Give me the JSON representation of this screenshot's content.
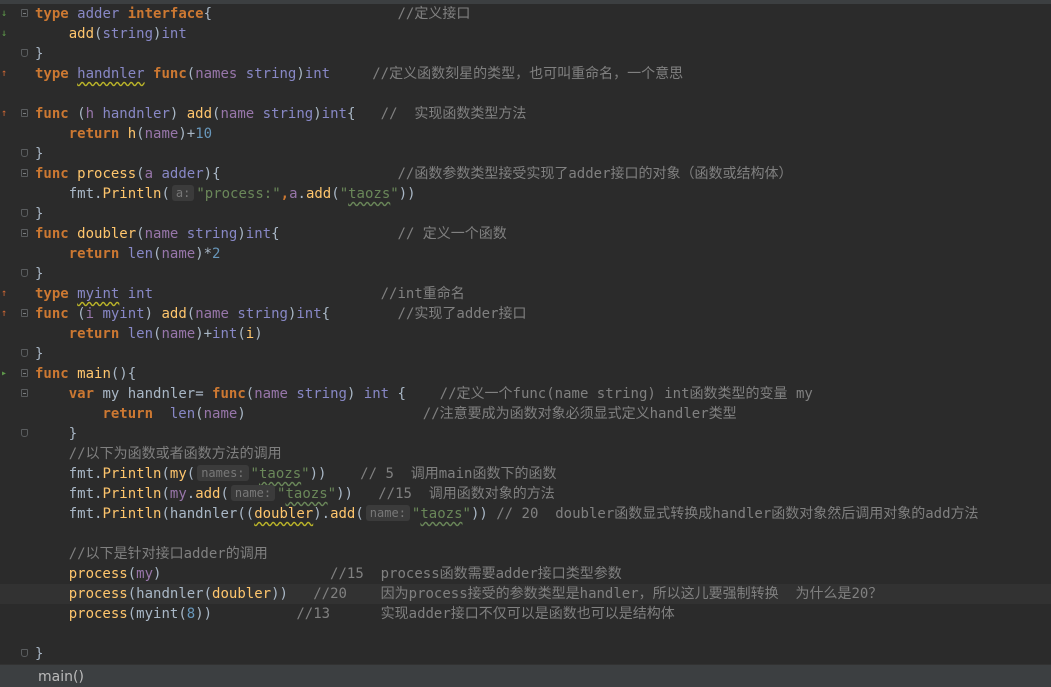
{
  "editor": {
    "line_tokens": [
      [
        [
          "kw",
          "type"
        ],
        [
          "pk",
          " "
        ],
        [
          "tp",
          "adder"
        ],
        [
          "pk",
          " "
        ],
        [
          "kw",
          "interface"
        ],
        [
          "pk",
          "{"
        ],
        [
          "cm",
          "                      //定义接口"
        ]
      ],
      [
        [
          "pk",
          "    "
        ],
        [
          "fn",
          "add"
        ],
        [
          "pk",
          "("
        ],
        [
          "tp",
          "string"
        ],
        [
          "pk",
          ")"
        ],
        [
          "tp",
          "int"
        ]
      ],
      [
        [
          "pk",
          "}"
        ]
      ],
      [
        [
          "kw",
          "type"
        ],
        [
          "pk",
          " "
        ],
        [
          "tp ul2",
          "handnler"
        ],
        [
          "pk",
          " "
        ],
        [
          "kw",
          "func"
        ],
        [
          "pk",
          "("
        ],
        [
          "pr",
          "names"
        ],
        [
          "pk",
          " "
        ],
        [
          "tp",
          "string"
        ],
        [
          "pk",
          ")"
        ],
        [
          "tp",
          "int"
        ],
        [
          "cm",
          "     //定义函数刻星的类型，也可叫重命名，一个意思"
        ]
      ],
      [],
      [
        [
          "kw",
          "func"
        ],
        [
          "pk",
          " ("
        ],
        [
          "pr",
          "h"
        ],
        [
          "pk",
          " "
        ],
        [
          "tp",
          "handnler"
        ],
        [
          "pk",
          ") "
        ],
        [
          "fn",
          "add"
        ],
        [
          "pk",
          "("
        ],
        [
          "pr",
          "name"
        ],
        [
          "pk",
          " "
        ],
        [
          "tp",
          "string"
        ],
        [
          "pk",
          ")"
        ],
        [
          "tp",
          "int"
        ],
        [
          "pk",
          "{"
        ],
        [
          "cm",
          "   //  实现函数类型方法"
        ]
      ],
      [
        [
          "pk",
          "    "
        ],
        [
          "kw",
          "return"
        ],
        [
          "pk",
          " "
        ],
        [
          "fn",
          "h"
        ],
        [
          "pk",
          "("
        ],
        [
          "pr",
          "name"
        ],
        [
          "pk",
          ")+"
        ],
        [
          "nm",
          "10"
        ]
      ],
      [
        [
          "pk",
          "}"
        ]
      ],
      [
        [
          "kw",
          "func"
        ],
        [
          "pk",
          " "
        ],
        [
          "fn",
          "process"
        ],
        [
          "pk",
          "("
        ],
        [
          "pr",
          "a"
        ],
        [
          "pk",
          " "
        ],
        [
          "tp",
          "adder"
        ],
        [
          "pk",
          "){"
        ],
        [
          "cm",
          "                     //函数参数类型接受实现了adder接口的对象（函数或结构体）"
        ]
      ],
      [
        [
          "pk",
          "    fmt."
        ],
        [
          "fn",
          "Println"
        ],
        [
          "pk",
          "("
        ],
        [
          "hint",
          "a:"
        ],
        [
          "st",
          "\"process:\""
        ],
        [
          "kw",
          ","
        ],
        [
          "pr",
          "a"
        ],
        [
          "pk",
          "."
        ],
        [
          "fn",
          "add"
        ],
        [
          "pk",
          "("
        ],
        [
          "st",
          "\""
        ],
        [
          "st ul",
          "taozs"
        ],
        [
          "st",
          "\""
        ],
        [
          "pk",
          "))"
        ]
      ],
      [
        [
          "pk",
          "}"
        ]
      ],
      [
        [
          "kw",
          "func"
        ],
        [
          "pk",
          " "
        ],
        [
          "fn",
          "doubler"
        ],
        [
          "pk",
          "("
        ],
        [
          "pr",
          "name"
        ],
        [
          "pk",
          " "
        ],
        [
          "tp",
          "string"
        ],
        [
          "pk",
          ")"
        ],
        [
          "tp",
          "int"
        ],
        [
          "pk",
          "{"
        ],
        [
          "cm",
          "              // 定义一个函数"
        ]
      ],
      [
        [
          "pk",
          "    "
        ],
        [
          "kw",
          "return"
        ],
        [
          "pk",
          " "
        ],
        [
          "tp",
          "len"
        ],
        [
          "pk",
          "("
        ],
        [
          "pr",
          "name"
        ],
        [
          "pk",
          ")*"
        ],
        [
          "nm",
          "2"
        ]
      ],
      [
        [
          "pk",
          "}"
        ]
      ],
      [
        [
          "kw",
          "type"
        ],
        [
          "pk",
          " "
        ],
        [
          "tp ul2",
          "myint"
        ],
        [
          "pk",
          " "
        ],
        [
          "tp",
          "int"
        ],
        [
          "cm",
          "                           //int重命名"
        ]
      ],
      [
        [
          "kw",
          "func"
        ],
        [
          "pk",
          " ("
        ],
        [
          "pr",
          "i"
        ],
        [
          "pk",
          " "
        ],
        [
          "tp",
          "myint"
        ],
        [
          "pk",
          ") "
        ],
        [
          "fn",
          "add"
        ],
        [
          "pk",
          "("
        ],
        [
          "pr",
          "name"
        ],
        [
          "pk",
          " "
        ],
        [
          "tp",
          "string"
        ],
        [
          "pk",
          ")"
        ],
        [
          "tp",
          "int"
        ],
        [
          "pk",
          "{"
        ],
        [
          "cm",
          "        //实现了adder接口"
        ]
      ],
      [
        [
          "pk",
          "    "
        ],
        [
          "kw",
          "return"
        ],
        [
          "pk",
          " "
        ],
        [
          "tp",
          "len"
        ],
        [
          "pk",
          "("
        ],
        [
          "pr",
          "name"
        ],
        [
          "pk",
          ")+"
        ],
        [
          "tp",
          "int"
        ],
        [
          "pk",
          "("
        ],
        [
          "fn",
          "i"
        ],
        [
          "pk",
          ")"
        ]
      ],
      [
        [
          "pk",
          "}"
        ]
      ],
      [
        [
          "kw",
          "func"
        ],
        [
          "pk",
          " "
        ],
        [
          "fn",
          "main"
        ],
        [
          "pk",
          "(){"
        ]
      ],
      [
        [
          "pk",
          "    "
        ],
        [
          "kw",
          "var"
        ],
        [
          "pk",
          " "
        ],
        [
          "vr",
          "my"
        ],
        [
          "pk",
          " "
        ],
        [
          "vr",
          "handnler"
        ],
        [
          "pk",
          "= "
        ],
        [
          "kw",
          "func"
        ],
        [
          "pk",
          "("
        ],
        [
          "pr",
          "name"
        ],
        [
          "pk",
          " "
        ],
        [
          "tp",
          "string"
        ],
        [
          "pk",
          ") "
        ],
        [
          "tp",
          "int"
        ],
        [
          "pk",
          " {"
        ],
        [
          "cm",
          "    //定义一个func(name string) int函数类型的变量 my"
        ]
      ],
      [
        [
          "pk",
          "        "
        ],
        [
          "kw",
          "return"
        ],
        [
          "pk",
          "  "
        ],
        [
          "tp",
          "len"
        ],
        [
          "pk",
          "("
        ],
        [
          "pr",
          "name"
        ],
        [
          "pk",
          ")"
        ],
        [
          "cm",
          "                     //注意要成为函数对象必须显式定义handler类型"
        ]
      ],
      [
        [
          "pk",
          "    }"
        ]
      ],
      [
        [
          "cm",
          "    //以下为函数或者函数方法的调用"
        ]
      ],
      [
        [
          "pk",
          "    fmt."
        ],
        [
          "fn",
          "Println"
        ],
        [
          "pk",
          "("
        ],
        [
          "fn",
          "my"
        ],
        [
          "pk",
          "("
        ],
        [
          "hint",
          "names:"
        ],
        [
          "st",
          "\""
        ],
        [
          "st ul",
          "taozs"
        ],
        [
          "st",
          "\""
        ],
        [
          "pk",
          "))"
        ],
        [
          "cm",
          "    // 5  调用main函数下的函数"
        ]
      ],
      [
        [
          "pk",
          "    fmt."
        ],
        [
          "fn",
          "Println"
        ],
        [
          "pk",
          "("
        ],
        [
          "pr",
          "my"
        ],
        [
          "pk",
          "."
        ],
        [
          "fn",
          "add"
        ],
        [
          "pk",
          "("
        ],
        [
          "hint",
          "name:"
        ],
        [
          "st",
          "\""
        ],
        [
          "st ul",
          "taozs"
        ],
        [
          "st",
          "\""
        ],
        [
          "pk",
          "))"
        ],
        [
          "cm",
          "   //15  调用函数对象的方法"
        ]
      ],
      [
        [
          "pk",
          "    fmt."
        ],
        [
          "fn",
          "Println"
        ],
        [
          "pk",
          "("
        ],
        [
          "vr",
          "handnler"
        ],
        [
          "pk",
          "(("
        ],
        [
          "fn ul2",
          "doubler"
        ],
        [
          "pk",
          ")."
        ],
        [
          "fn",
          "add"
        ],
        [
          "pk",
          "("
        ],
        [
          "hint",
          "name:"
        ],
        [
          "st",
          "\""
        ],
        [
          "st ul",
          "taozs"
        ],
        [
          "st",
          "\""
        ],
        [
          "pk",
          "))"
        ],
        [
          "cm",
          " // 20  doubler函数显式转换成handler函数对象然后调用对象的add方法"
        ]
      ],
      [],
      [
        [
          "cm",
          "    //以下是针对接口adder的调用"
        ]
      ],
      [
        [
          "pk",
          "    "
        ],
        [
          "fn",
          "process"
        ],
        [
          "pk",
          "("
        ],
        [
          "pr",
          "my"
        ],
        [
          "pk",
          ")"
        ],
        [
          "cm",
          "                    //15  process函数需要adder接口类型参数"
        ]
      ],
      [
        [
          "pk",
          "    "
        ],
        [
          "fn",
          "process"
        ],
        [
          "pk",
          "("
        ],
        [
          "vr",
          "handnler"
        ],
        [
          "pk",
          "("
        ],
        [
          "fn",
          "doubler"
        ],
        [
          "pk",
          "))"
        ],
        [
          "cm",
          "   //20    因为process接受的参数类型是handler，所以这儿要强制转换  为什么是20？"
        ]
      ],
      [
        [
          "pk",
          "    "
        ],
        [
          "fn",
          "process"
        ],
        [
          "pk",
          "("
        ],
        [
          "vr",
          "myint"
        ],
        [
          "pk",
          "("
        ],
        [
          "nm",
          "8"
        ],
        [
          "pk",
          "))"
        ],
        [
          "cm",
          "          //13      实现adder接口不仅可以是函数也可以是结构体"
        ]
      ],
      [],
      [
        [
          "pk",
          "}"
        ]
      ]
    ],
    "gutter": [
      {
        "marker": "↓",
        "type": "impl",
        "fold": "open"
      },
      {
        "marker": "↓",
        "type": "impl",
        "fold": ""
      },
      {
        "marker": "",
        "type": "",
        "fold": "end"
      },
      {
        "marker": "↑",
        "type": "iface",
        "fold": ""
      },
      {
        "marker": "",
        "type": "",
        "fold": ""
      },
      {
        "marker": "↑",
        "type": "iface",
        "fold": "open"
      },
      {
        "marker": "",
        "type": "",
        "fold": ""
      },
      {
        "marker": "",
        "type": "",
        "fold": "end"
      },
      {
        "marker": "",
        "type": "",
        "fold": "open"
      },
      {
        "marker": "",
        "type": "",
        "fold": ""
      },
      {
        "marker": "",
        "type": "",
        "fold": "end"
      },
      {
        "marker": "",
        "type": "",
        "fold": "open"
      },
      {
        "marker": "",
        "type": "",
        "fold": ""
      },
      {
        "marker": "",
        "type": "",
        "fold": "end"
      },
      {
        "marker": "↑",
        "type": "iface",
        "fold": ""
      },
      {
        "marker": "↑",
        "type": "iface",
        "fold": "open"
      },
      {
        "marker": "",
        "type": "",
        "fold": ""
      },
      {
        "marker": "",
        "type": "",
        "fold": "end"
      },
      {
        "marker": "▸",
        "type": "run",
        "fold": "open"
      },
      {
        "marker": "",
        "type": "",
        "fold": "open"
      },
      {
        "marker": "",
        "type": "",
        "fold": ""
      },
      {
        "marker": "",
        "type": "",
        "fold": "end"
      },
      {
        "marker": "",
        "type": "",
        "fold": ""
      },
      {
        "marker": "",
        "type": "",
        "fold": ""
      },
      {
        "marker": "",
        "type": "",
        "fold": ""
      },
      {
        "marker": "",
        "type": "",
        "fold": ""
      },
      {
        "marker": "",
        "type": "",
        "fold": ""
      },
      {
        "marker": "",
        "type": "",
        "fold": ""
      },
      {
        "marker": "",
        "type": "",
        "fold": ""
      },
      {
        "marker": "",
        "type": "",
        "fold": ""
      },
      {
        "marker": "",
        "type": "",
        "fold": ""
      },
      {
        "marker": "",
        "type": "",
        "fold": ""
      },
      {
        "marker": "",
        "type": "",
        "fold": "end"
      }
    ],
    "highlighted_line": 29
  },
  "statusbar": {
    "breadcrumb": "main()"
  }
}
